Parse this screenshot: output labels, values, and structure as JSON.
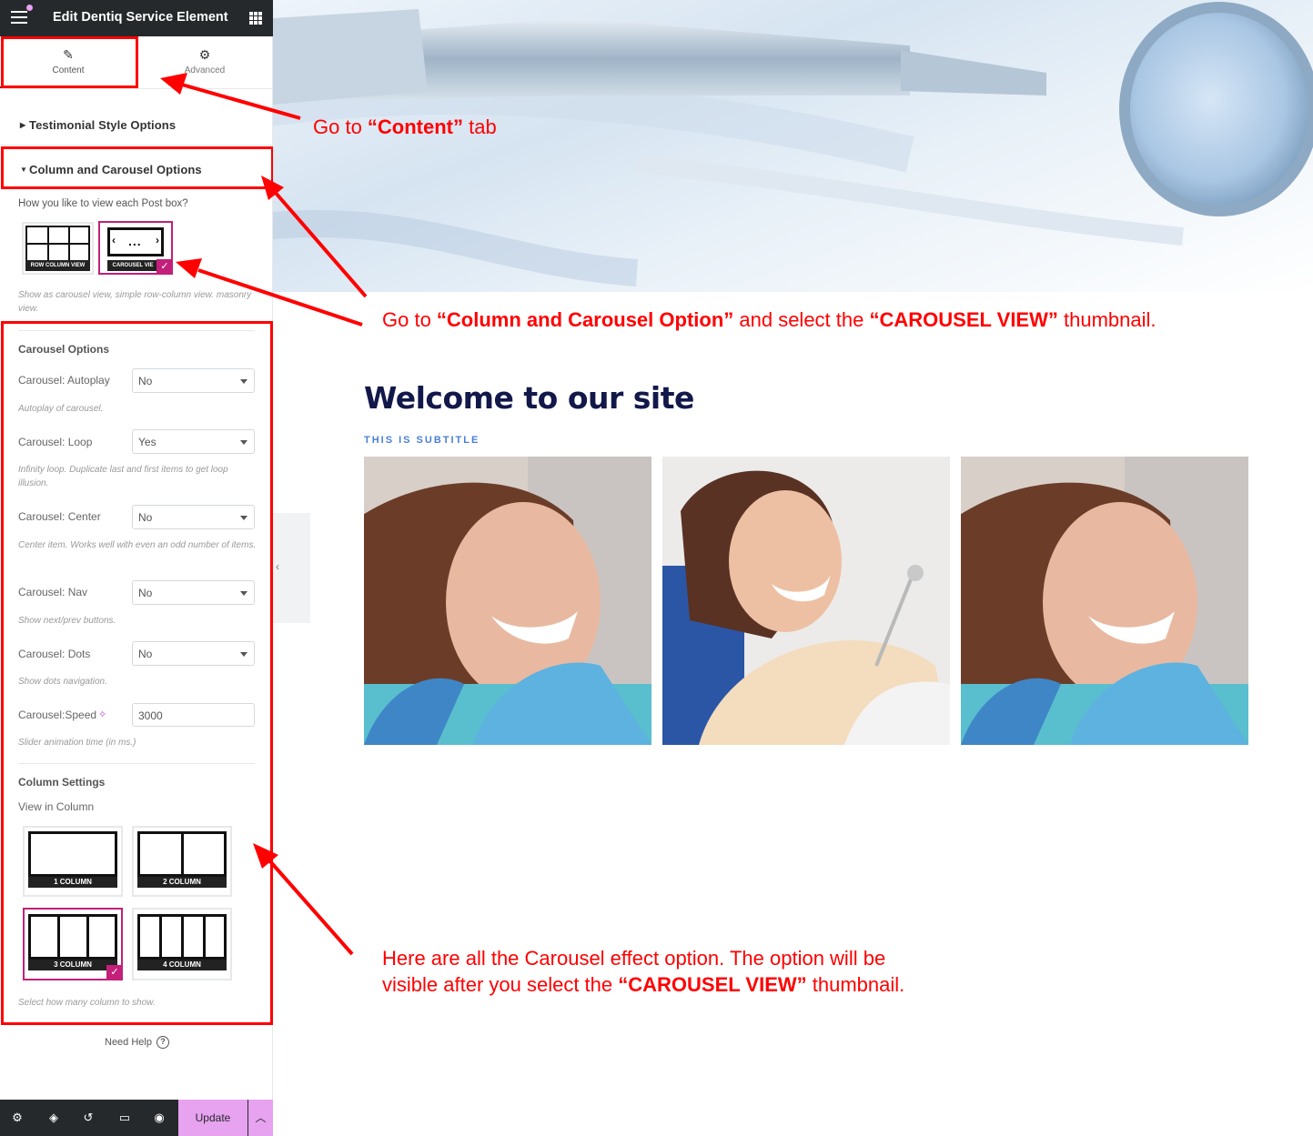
{
  "sidebar": {
    "title": "Edit Dentiq Service Element",
    "tabs": [
      {
        "label": "Content",
        "icon": "pencil-icon"
      },
      {
        "label": "Advanced",
        "icon": "gear-icon"
      }
    ],
    "sections": {
      "testimonial": "Testimonial Style Options",
      "column_carousel": "Column and Carousel Options"
    },
    "view_question": "How you like to view each Post box?",
    "view_options": [
      {
        "label": "ROW COLUMN VIEW",
        "selected": false
      },
      {
        "label": "CAROUSEL VIE",
        "selected": true
      }
    ],
    "view_desc": "Show as carousel view, simple row-column view. masonry view.",
    "carousel_options_heading": "Carousel Options",
    "fields": [
      {
        "label": "Carousel: Autoplay",
        "value": "No",
        "desc": "Autoplay of carousel."
      },
      {
        "label": "Carousel: Loop",
        "value": "Yes",
        "desc": "Infinity loop. Duplicate last and first items to get loop illusion."
      },
      {
        "label": "Carousel: Center",
        "value": "No",
        "desc": "Center item. Works well with even an odd number of items."
      },
      {
        "label": "Carousel: Nav",
        "value": "No",
        "desc": "Show next/prev buttons."
      },
      {
        "label": "Carousel: Dots",
        "value": "No",
        "desc": "Show dots navigation."
      }
    ],
    "speed": {
      "label": "Carousel:Speed",
      "value": "3000",
      "desc": "Slider animation time (in ms.)"
    },
    "column_settings_heading": "Column Settings",
    "view_in_column": "View in Column",
    "columns": [
      {
        "label": "1 COLUMN",
        "selected": false
      },
      {
        "label": "2 COLUMN",
        "selected": false
      },
      {
        "label": "3 COLUMN",
        "selected": true
      },
      {
        "label": "4 COLUMN",
        "selected": false
      }
    ],
    "columns_desc": "Select how many column to show.",
    "need_help": "Need Help",
    "bottom": {
      "icons": [
        "settings-icon",
        "layers-icon",
        "history-icon",
        "responsive-icon",
        "preview-eye-icon"
      ],
      "update_label": "Update"
    }
  },
  "preview": {
    "heading": "Welcome to our site",
    "subtitle": "THIS IS SUBTITLE",
    "images": [
      "dental-patient-photo-1",
      "dental-patient-photo-2",
      "dental-patient-photo-3"
    ]
  },
  "annotations": {
    "a1_pre": "Go  to ",
    "a1_bold": "“Content”",
    "a1_post": " tab",
    "a2_pre": "Go to ",
    "a2_bold1": "“Column and Carousel Option”",
    "a2_mid": " and select the ",
    "a2_bold2": "“CAROUSEL VIEW”",
    "a2_post": " thumbnail.",
    "a3_line1": "Here are all the Carousel effect option. The option will be",
    "a3_pre": "visible after you select the ",
    "a3_bold": "“CAROUSEL VIEW”",
    "a3_post": " thumbnail."
  },
  "colors": {
    "accent": "#c2207a",
    "annotation": "#ff0000",
    "update_button": "#e7a2f0",
    "topbar": "#26292c"
  }
}
